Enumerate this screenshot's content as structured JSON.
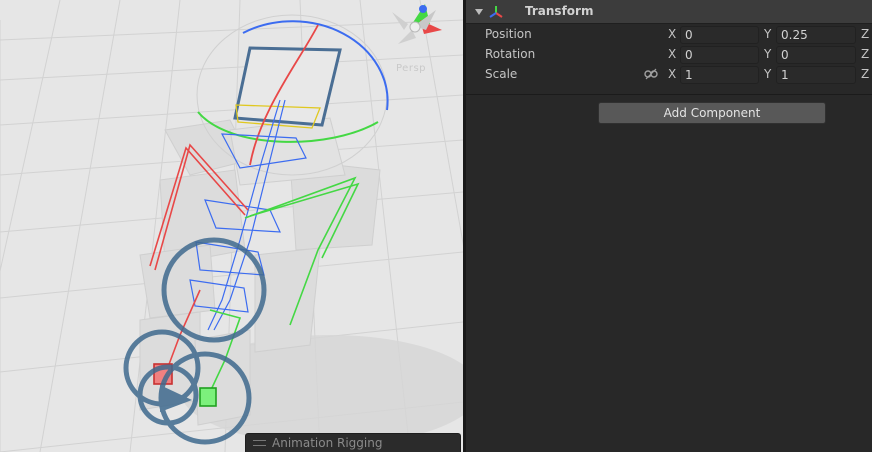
{
  "scene": {
    "projection_label": "Persp",
    "overlay_tab_label": "Animation Rigging"
  },
  "inspector": {
    "component": {
      "title": "Transform",
      "icon": "transform-icon"
    },
    "rows": {
      "position": {
        "label": "Position",
        "x": "0",
        "y": "0.25",
        "z_axis": "Z"
      },
      "rotation": {
        "label": "Rotation",
        "x": "0",
        "y": "0",
        "z_axis": "Z"
      },
      "scale": {
        "label": "Scale",
        "x": "1",
        "y": "1",
        "z_axis": "Z"
      }
    },
    "axes": {
      "x": "X",
      "y": "Y"
    },
    "add_component_label": "Add Component"
  },
  "colors": {
    "scene_background": "#e6e6e6",
    "panel_background": "#282828",
    "header_background": "#3c3c3c",
    "axis_red": "#e84848",
    "axis_green": "#44d844",
    "axis_blue": "#3c6cf0",
    "selection_outline": "#4a6e94"
  }
}
